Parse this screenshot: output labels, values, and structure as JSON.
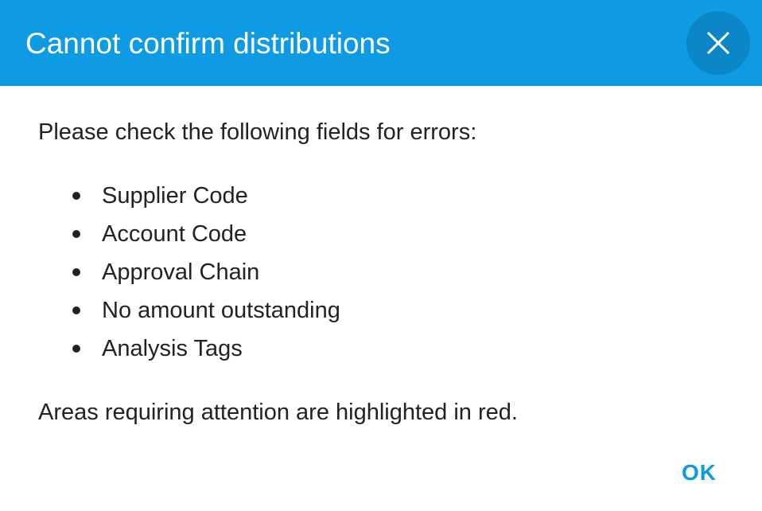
{
  "dialog": {
    "title": "Cannot confirm distributions",
    "intro": "Please check the following fields for errors:",
    "errors": [
      "Supplier Code",
      "Account Code",
      "Approval Chain",
      "No amount outstanding",
      "Analysis Tags"
    ],
    "note": "Areas requiring attention are highlighted in red.",
    "ok_label": "OK",
    "close_icon": "close-icon"
  },
  "colors": {
    "header_bg": "#0e9be3",
    "close_button_bg": "#0b86c6",
    "accent": "#0e9be3",
    "text": "#222222"
  }
}
